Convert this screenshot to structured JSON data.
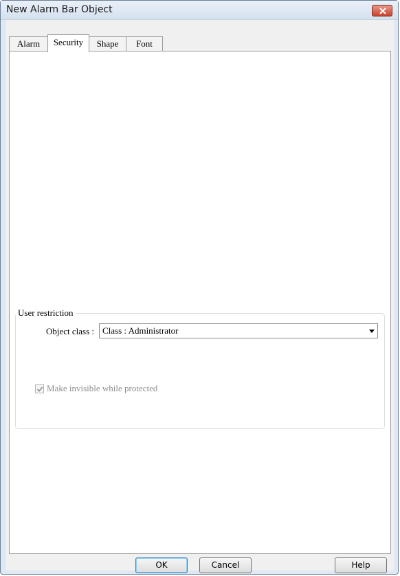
{
  "window": {
    "title": "New Alarm Bar Object"
  },
  "tabs": [
    {
      "label": "Alarm"
    },
    {
      "label": "Security",
      "selected": true
    },
    {
      "label": "Shape"
    },
    {
      "label": "Font"
    }
  ],
  "user_restriction": {
    "group_label": "User restriction",
    "object_class_label": "Object class :",
    "object_class_value": "Class : Administrator",
    "invisible_checkbox": {
      "label": "Make invisible while protected",
      "checked": true,
      "enabled": false
    }
  },
  "buttons": {
    "ok": "OK",
    "cancel": "Cancel",
    "help": "Help"
  },
  "colors": {
    "title_bar": "#dfe8f3",
    "close_button": "#c9412c",
    "default_button_border": "#3c7fb1"
  },
  "icons": {
    "close": "close-icon",
    "dropdown": "chevron-down-icon",
    "check": "check-icon"
  }
}
